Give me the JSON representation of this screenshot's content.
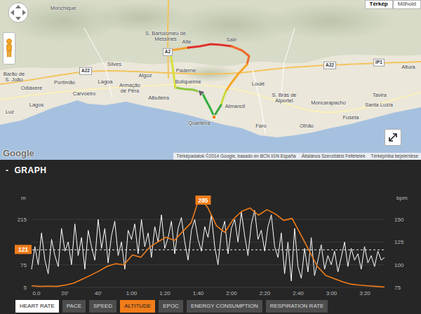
{
  "map": {
    "places": [
      "Monchique",
      "S. Bartolomeu de Messines",
      "Silves",
      "Alte",
      "Salir",
      "Paderne",
      "Algoz",
      "Boliqueime",
      "Loulé",
      "S. Brás de Alportel",
      "Almancil",
      "Quarteira",
      "Faro",
      "Olhão",
      "Fuseta",
      "Moncarapacho",
      "Santa Luzia",
      "Tavira",
      "Altura",
      "Portimão",
      "Lagoa",
      "Armação de Pêra",
      "Albufeira",
      "Carvoeiro",
      "Lagos",
      "Odiáxere",
      "Barão de S. João",
      "Luz"
    ],
    "roads": [
      "A22",
      "A22",
      "IP1",
      "A2"
    ],
    "route": [
      {
        "color": "#2fae3e"
      },
      {
        "color": "#8cc63f"
      },
      {
        "color": "#d6df3a"
      },
      {
        "color": "#f2a231"
      },
      {
        "color": "#e0312b"
      },
      {
        "color": "#ee6b2c"
      },
      {
        "color": "#f5a623"
      },
      {
        "color": "#c9dc3a"
      },
      {
        "color": "#3aa640"
      }
    ],
    "map_types": [
      {
        "label": "Térkép",
        "selected": true
      },
      {
        "label": "Műhold",
        "selected": false
      }
    ],
    "logo": "Google",
    "attribution": [
      "Térképadatok ©2014 Google, basado en BCN IGN España",
      "Általános Szerződési Feltételek",
      "Térképhiba bejelentése"
    ]
  },
  "graph": {
    "toggle": "-",
    "title": "GRAPH"
  },
  "chart": {
    "left_unit": "m",
    "left_ticks": [
      "215",
      "75",
      "5"
    ],
    "right_unit": "bpm",
    "right_ticks": [
      "150",
      "125",
      "100",
      "75"
    ],
    "x_ticks": [
      "0.0",
      "20'",
      "40'",
      "1:00",
      "1:20",
      "1:40",
      "2:00",
      "2:20",
      "2:40",
      "3:00",
      "3:20"
    ],
    "reference_badge": "121",
    "peak_badge": "285",
    "series": [
      {
        "axis": "right",
        "color": "#ffffff",
        "values": [
          95,
          120,
          100,
          135,
          105,
          90,
          128,
          110,
          98,
          140,
          115,
          125,
          100,
          145,
          110,
          130,
          95,
          138,
          120,
          105,
          150,
          118,
          140,
          102,
          132,
          148,
          110,
          125,
          95,
          138,
          128,
          145,
          112,
          150,
          120,
          135,
          108,
          142,
          125,
          155,
          118,
          130,
          148,
          112,
          140,
          152,
          125,
          105,
          138,
          150,
          128,
          115,
          142,
          130,
          155,
          120,
          100,
          135,
          148,
          112,
          140,
          150,
          125,
          158,
          132,
          110,
          145,
          160,
          128,
          138,
          115,
          142,
          155,
          120,
          108,
          135,
          90,
          125,
          82,
          140,
          98,
          85,
          118,
          92,
          130,
          88,
          105,
          122,
          95,
          110,
          100,
          115,
          92,
          108,
          125,
          98,
          118,
          105,
          112,
          95,
          120,
          102,
          110,
          98,
          115,
          105,
          108
        ]
      },
      {
        "axis": "left",
        "color": "#f07d1a",
        "values": [
          10,
          8,
          9,
          8,
          12,
          18,
          30,
          42,
          55,
          70,
          78,
          75,
          105,
          98,
          128,
          145,
          160,
          150,
          178,
          205,
          285,
          250,
          195,
          175,
          215,
          240,
          250,
          228,
          245,
          232,
          212,
          218,
          170,
          120,
          70,
          42,
          32,
          22,
          15,
          12,
          10,
          8,
          6
        ]
      }
    ]
  },
  "buttons": [
    {
      "label": "HEART RATE",
      "selected": true,
      "color": "#ffffff"
    },
    {
      "label": "PACE",
      "selected": false,
      "color": "#4d4d4d"
    },
    {
      "label": "SPEED",
      "selected": false,
      "color": "#4d4d4d"
    },
    {
      "label": "ALTITUDE",
      "selected": true,
      "color": "#f07d1a"
    },
    {
      "label": "EPOC",
      "selected": false,
      "color": "#4d4d4d"
    },
    {
      "label": "ENERGY CONSUMPTION",
      "selected": false,
      "color": "#4d4d4d"
    },
    {
      "label": "RESPIRATION RATE",
      "selected": false,
      "color": "#4d4d4d"
    }
  ]
}
